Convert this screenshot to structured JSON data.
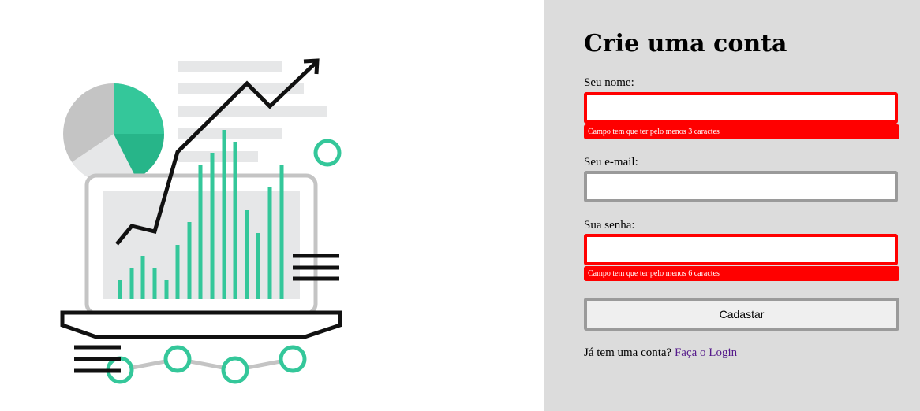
{
  "form": {
    "title": "Crie uma conta",
    "name": {
      "label": "Seu nome:",
      "value": "",
      "error": "Campo tem que ter pelo menos 3 caractes"
    },
    "email": {
      "label": "Seu e-mail:",
      "value": ""
    },
    "password": {
      "label": "Sua senha:",
      "value": "",
      "error": "Campo tem que ter pelo menos 6 caractes"
    },
    "submit_label": "Cadastar",
    "login_prompt": "Já tem uma conta?",
    "login_link": "Faça o Login"
  },
  "colors": {
    "form_background": "#dcdcdc",
    "error": "#ff0000",
    "input_border": "#9a9a9a",
    "accent_green": "#34c79a",
    "link": "#551a8b"
  },
  "illustration": {
    "icon": "analytics-laptop-illustration"
  }
}
